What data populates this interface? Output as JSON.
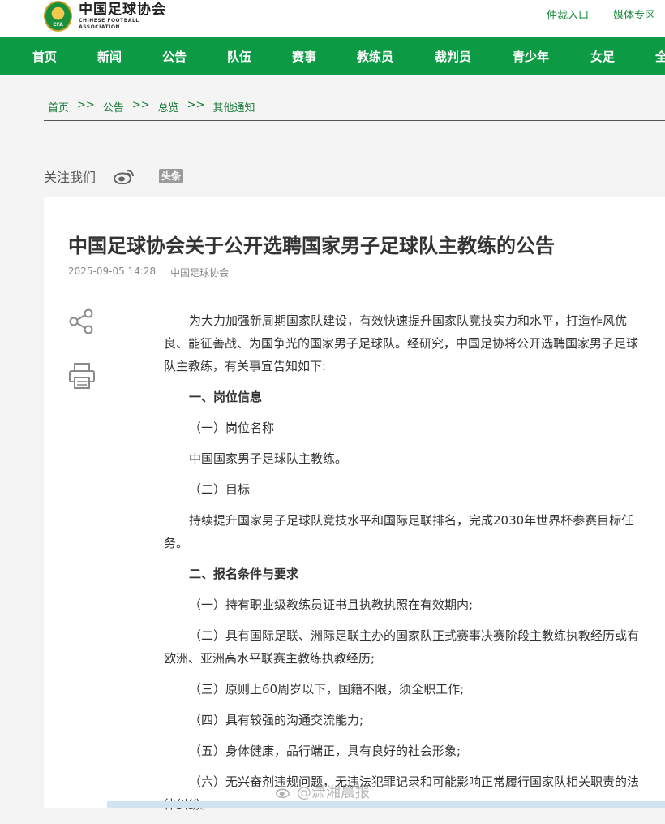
{
  "header": {
    "logo_cn": "中国足球协会",
    "logo_en": "CHINESE FOOTBALL ASSOCIATION",
    "logo_badge": "CFA",
    "links": [
      "仲裁入口",
      "媒体专区"
    ]
  },
  "nav": [
    "首页",
    "新闻",
    "公告",
    "队伍",
    "赛事",
    "教练员",
    "裁判员",
    "青少年",
    "女足",
    "全"
  ],
  "breadcrumb": [
    "首页",
    "公告",
    "总览",
    "其他通知"
  ],
  "breadcrumb_sep": ">>",
  "follow": {
    "label": "关注我们",
    "toutiao": "头条"
  },
  "article": {
    "title": "中国足球协会关于公开选聘国家男子足球队主教练的公告",
    "date": "2025-09-05 14:28",
    "source": "中国足球协会",
    "paragraphs": [
      "为大力加强新周期国家队建设，有效快速提升国家队竞技实力和水平，打造作风优良、能征善战、为国争光的国家男子足球队。经研究，中国足协将公开选聘国家男子足球队主教练，有关事宜告知如下:",
      "一、岗位信息",
      "（一）岗位名称",
      "中国国家男子足球队主教练。",
      "（二）目标",
      "持续提升国家男子足球队竞技水平和国际足联排名，完成2030年世界杯参赛目标任务。",
      "二、报名条件与要求",
      "（一）持有职业级教练员证书且执教执照在有效期内;",
      "（二）具有国际足联、洲际足联主办的国家队正式赛事决赛阶段主教练执教经历或有欧洲、亚洲高水平联赛主教练执教经历;",
      "（三）原则上60周岁以下，国籍不限，须全职工作;",
      "（四）具有较强的沟通交流能力;",
      "（五）身体健康，品行端正，具有良好的社会形象;",
      "（六）无兴奋剂违规问题，无违法犯罪记录和可能影响正常履行国家队相关职责的法律纠纷。"
    ]
  },
  "watermark": "@潇湘晨报",
  "colors": {
    "green": "#0c9a44",
    "link_green": "#17883b"
  }
}
